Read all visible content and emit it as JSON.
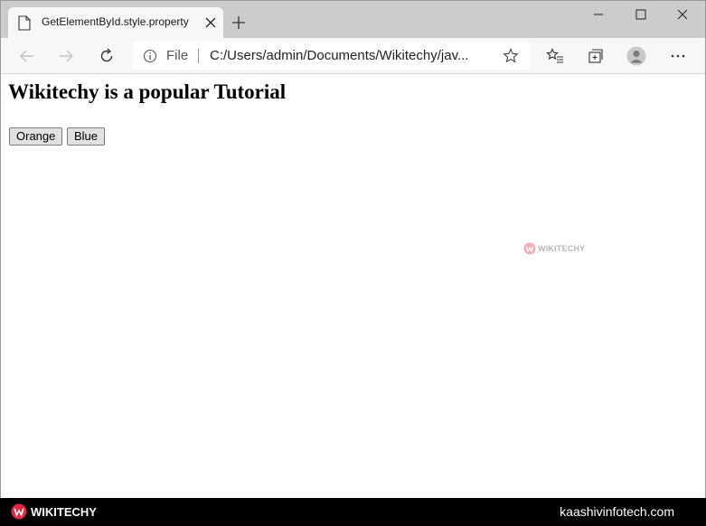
{
  "browser": {
    "tab_title": "GetElementById.style.property",
    "address": {
      "scheme": "File",
      "url": "C:/Users/admin/Documents/Wikitechy/jav..."
    },
    "icons": [
      "page-icon",
      "close-icon",
      "plus-icon",
      "minimize-icon",
      "maximize-icon",
      "close-window-icon",
      "back-arrow-icon",
      "forward-arrow-icon",
      "refresh-icon",
      "info-icon",
      "star-icon",
      "favorites-icon",
      "collections-icon",
      "profile-icon",
      "more-icon"
    ]
  },
  "page": {
    "heading": "Wikitechy is a popular Tutorial",
    "buttons": [
      {
        "label": "Orange"
      },
      {
        "label": "Blue"
      }
    ],
    "watermark": "WIKITECHY"
  },
  "footer": {
    "brand": "WIKITECHY",
    "site": "kaashivinfotech.com"
  },
  "colors": {
    "tabstrip": "#cccccc",
    "toolbar": "#f7f7f7",
    "brand_red": "#e02945",
    "footer_bg": "#000000"
  }
}
